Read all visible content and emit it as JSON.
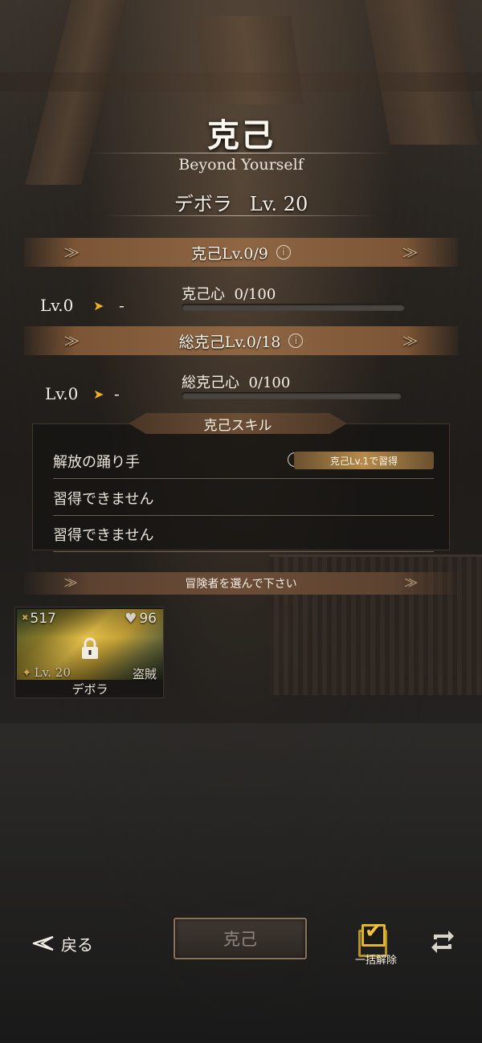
{
  "screen": {
    "title": "克己",
    "subtitle": "Beyond Yourself",
    "character_name": "デボラ",
    "character_level": "Lv. 20"
  },
  "overcome": {
    "header": "克己Lv.0/9",
    "current_level": "Lv.0",
    "next_level": "-",
    "resource_label": "克己心",
    "resource_value": "0/100",
    "progress": 0
  },
  "total_overcome": {
    "header": "総克己Lv.0/18",
    "current_level": "Lv.0",
    "next_level": "-",
    "resource_label": "総克己心",
    "resource_value": "0/100",
    "progress": 0
  },
  "skills": {
    "header": "克己スキル",
    "items": [
      {
        "name": "解放の踊り手",
        "requirement": "克己Lv.1で習得"
      },
      {
        "name": "習得できません"
      },
      {
        "name": "習得できません"
      }
    ]
  },
  "select_prompt": "冒険者を選んで下さい",
  "adventurers": [
    {
      "attack": "517",
      "hp": "96",
      "level": "Lv. 20",
      "class": "盗賊",
      "name": "デボラ",
      "locked": true
    }
  ],
  "footer": {
    "back_label": "戻る",
    "main_button_label": "克己",
    "batch_label": "一括解除"
  },
  "colors": {
    "accent_gold": "#e2b52a",
    "band_brown": "#8e6644",
    "arrow_orange": "#f0b020"
  }
}
